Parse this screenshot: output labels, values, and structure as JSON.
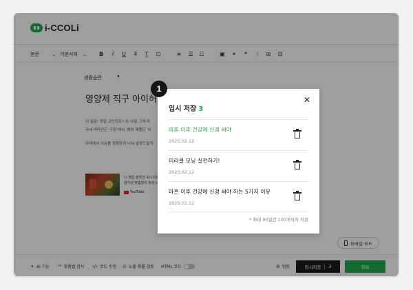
{
  "app": {
    "logo_text": "i-CCOLi"
  },
  "toolbar": {
    "paragraph": "본문",
    "font": "기본서체",
    "format_icons": [
      "bold-icon",
      "italic-icon",
      "underline-icon",
      "strikethrough-icon",
      "clear-format-icon",
      "text-box-icon"
    ],
    "format_glyphs": [
      "B",
      "I",
      "U",
      "T",
      "T̲",
      "⊡"
    ],
    "list_icons": [
      "align-left-icon",
      "bullet-list-icon",
      "numbered-list-icon"
    ],
    "list_glyphs": [
      "≡",
      "☰",
      "☷"
    ],
    "insert_icons": [
      "image-icon",
      "link-icon",
      "quote-icon",
      "divider-icon",
      "table-icon",
      "folder-icon"
    ],
    "insert_glyphs": [
      "▣",
      "⚭",
      "❝",
      "⁝",
      "⊞",
      "⊟"
    ]
  },
  "editor": {
    "category": "생활습관",
    "title": "영양제 직구 아이허브",
    "body_lines": [
      "이 질문! 정말 고민되죠? 😊 사실 그에 리",
      "국내 비타민은 '구팡'에서, 해외 제품은 '아",
      "아래에서 이유를 정확하게 나눠 설명드릴게"
    ],
    "link_card": {
      "lines": [
        "나 챙길 솔루션 모니터큐",
        "알아낸 맞춤형의 정성스",
        "YouTube"
      ]
    }
  },
  "mobile_mode": "모바일 모드",
  "bottom_bar": {
    "ai": "AI 기능",
    "spell": "맞춤법 검사",
    "code": "코드 수정",
    "exposure": "노출 확률 검토",
    "html": "HTML 코드",
    "policy": "범원",
    "draft_label": "임시저장",
    "draft_count": "3",
    "publish": "완료"
  },
  "modal": {
    "step_number": "1",
    "title": "임시 저장",
    "count": "3",
    "items": [
      {
        "title": "마혼 이후 건강에 신경 써야",
        "date": "2025.02.12",
        "active": true
      },
      {
        "title": "미라클 모닝 실천하기!",
        "date": "2025.02.12",
        "active": false
      },
      {
        "title": "마흔 이후 건강에 신경 써야 하는 5가지 이유",
        "date": "2025.02.12",
        "active": false
      }
    ],
    "note": "* 최대 90일간 100개까지 저장"
  },
  "colors": {
    "accent": "#1faa4d",
    "dark_button": "#1c1c1c",
    "overlay": "rgba(0,0,0,0.38)"
  }
}
